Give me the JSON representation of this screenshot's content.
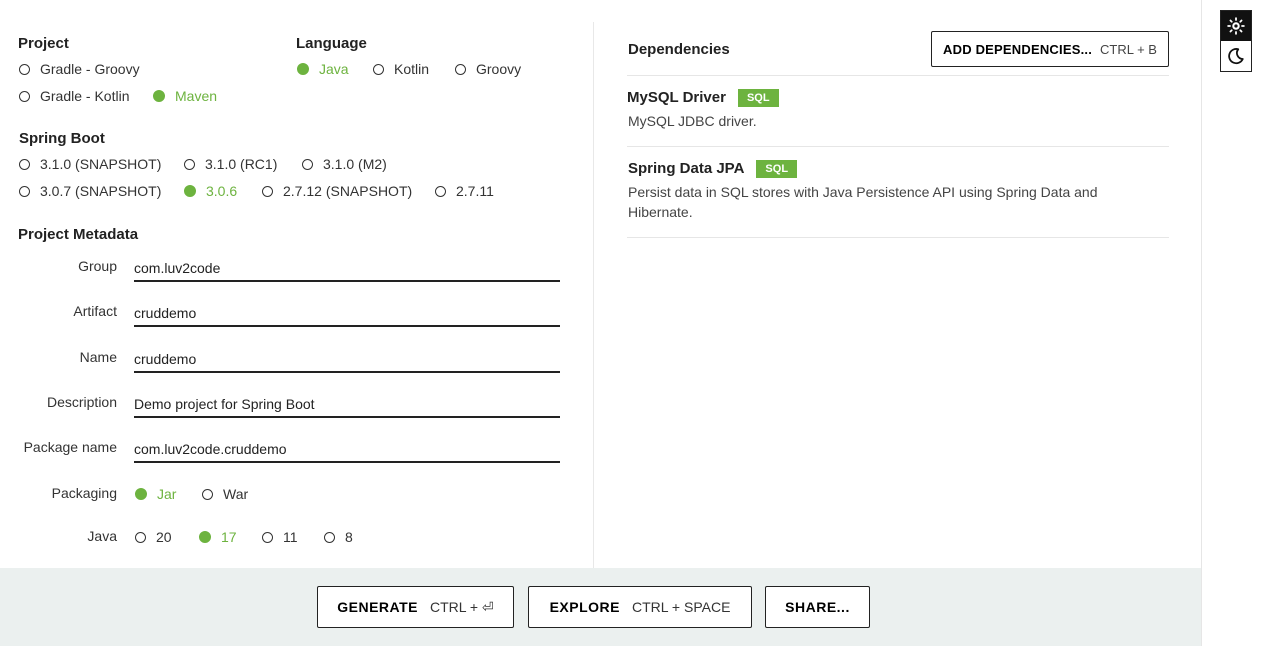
{
  "project": {
    "heading": "Project",
    "options": [
      "Gradle - Groovy",
      "Gradle - Kotlin",
      "Maven"
    ],
    "selected": "Maven"
  },
  "language": {
    "heading": "Language",
    "options": [
      "Java",
      "Kotlin",
      "Groovy"
    ],
    "selected": "Java"
  },
  "spring_boot": {
    "heading": "Spring Boot",
    "options": [
      "3.1.0 (SNAPSHOT)",
      "3.1.0 (RC1)",
      "3.1.0 (M2)",
      "3.0.7 (SNAPSHOT)",
      "3.0.6",
      "2.7.12 (SNAPSHOT)",
      "2.7.11"
    ],
    "selected": "3.0.6"
  },
  "metadata": {
    "heading": "Project Metadata",
    "fields": [
      {
        "label": "Group",
        "value": "com.luv2code"
      },
      {
        "label": "Artifact",
        "value": "cruddemo"
      },
      {
        "label": "Name",
        "value": "cruddemo"
      },
      {
        "label": "Description",
        "value": "Demo project for Spring Boot"
      },
      {
        "label": "Package name",
        "value": "com.luv2code.cruddemo"
      }
    ],
    "packaging": {
      "label": "Packaging",
      "options": [
        "Jar",
        "War"
      ],
      "selected": "Jar"
    },
    "java": {
      "label": "Java",
      "options": [
        "20",
        "17",
        "11",
        "8"
      ],
      "selected": "17"
    }
  },
  "dependencies": {
    "heading": "Dependencies",
    "add_button": {
      "label": "ADD DEPENDENCIES...",
      "shortcut": "CTRL + B"
    },
    "items": [
      {
        "name": "MySQL Driver",
        "badge": "SQL",
        "description": "MySQL JDBC driver."
      },
      {
        "name": "Spring Data JPA",
        "badge": "SQL",
        "description": "Persist data in SQL stores with Java Persistence API using Spring Data and Hibernate."
      }
    ]
  },
  "footer": {
    "generate": {
      "label": "GENERATE",
      "shortcut": "CTRL + ⏎"
    },
    "explore": {
      "label": "EXPLORE",
      "shortcut": "CTRL + SPACE"
    },
    "share": {
      "label": "SHARE..."
    }
  },
  "theme": {
    "active": "light",
    "icons": [
      "sun-icon",
      "moon-icon"
    ]
  },
  "colors": {
    "accent": "#6db33f",
    "footer_bg": "#ebf0ef",
    "text": "#222222"
  }
}
